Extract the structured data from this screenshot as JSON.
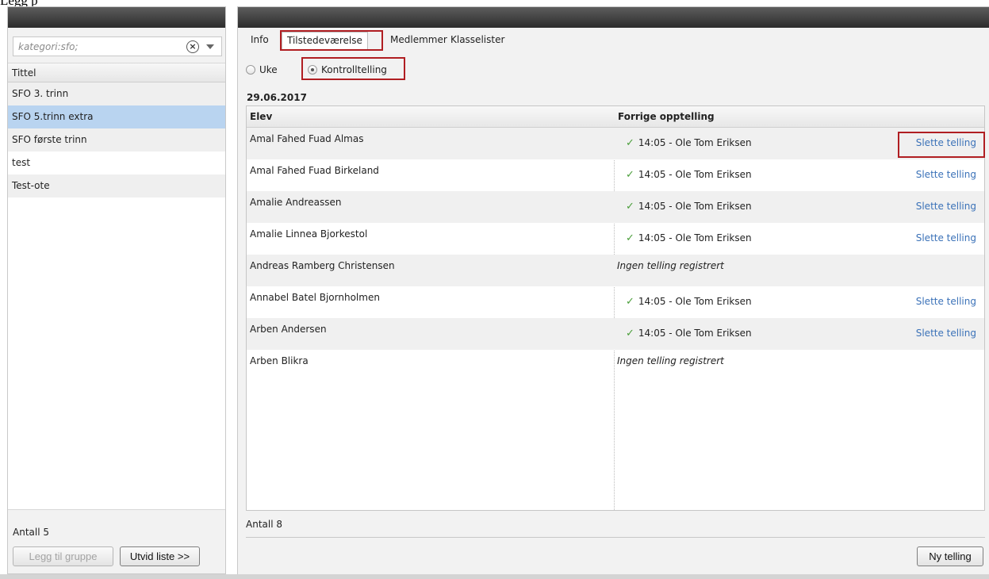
{
  "document_text": "Legg p",
  "left_panel": {
    "filter": {
      "placeholder": "kategori:sfo;",
      "value": ""
    },
    "column_header": "Tittel",
    "items": [
      {
        "label": "SFO 3. trinn",
        "selected": false
      },
      {
        "label": "SFO 5.trinn extra",
        "selected": true
      },
      {
        "label": "SFO første trinn",
        "selected": false
      },
      {
        "label": "test",
        "selected": false
      },
      {
        "label": "Test-ote",
        "selected": false
      }
    ],
    "count": "Antall 5",
    "add_group_label": "Legg til gruppe",
    "expand_label": "Utvid liste >>"
  },
  "tabs": [
    {
      "label": "Info",
      "active": false
    },
    {
      "label": "Tilstedeværelse",
      "active": true
    },
    {
      "label": "Medlemmer",
      "active": false
    },
    {
      "label": "Klasselister",
      "active": false
    }
  ],
  "view_options": [
    {
      "label": "Uke",
      "checked": false
    },
    {
      "label": "Kontrolltelling",
      "checked": true
    }
  ],
  "date": "29.06.2017",
  "grid": {
    "columns": [
      "Elev",
      "Forrige opptelling"
    ],
    "rows": [
      {
        "name": "Amal Fahed Fuad Almas",
        "count": "14:05 - Ole Tom Eriksen",
        "action": "Slette telling"
      },
      {
        "name": "Amal Fahed Fuad Birkeland",
        "count": "14:05 - Ole Tom Eriksen",
        "action": "Slette telling"
      },
      {
        "name": "Amalie Andreassen",
        "count": "14:05 - Ole Tom Eriksen",
        "action": "Slette telling"
      },
      {
        "name": "Amalie Linnea Bjorkestol",
        "count": "14:05 - Ole Tom Eriksen",
        "action": "Slette telling"
      },
      {
        "name": "Andreas Ramberg Christensen",
        "none": "Ingen telling registrert"
      },
      {
        "name": "Annabel Batel Bjornholmen",
        "count": "14:05 - Ole Tom Eriksen",
        "action": "Slette telling"
      },
      {
        "name": "Arben Andersen",
        "count": "14:05 - Ole Tom Eriksen",
        "action": "Slette telling"
      },
      {
        "name": "Arben Blikra",
        "none": "Ingen telling registrert"
      }
    ]
  },
  "count": "Antall 8",
  "new_count_label": "Ny telling",
  "colors": {
    "highlight_border": "#b01e22",
    "selection": "#b9d4f0",
    "link": "#3b72b8",
    "check": "#4a9e3a"
  }
}
